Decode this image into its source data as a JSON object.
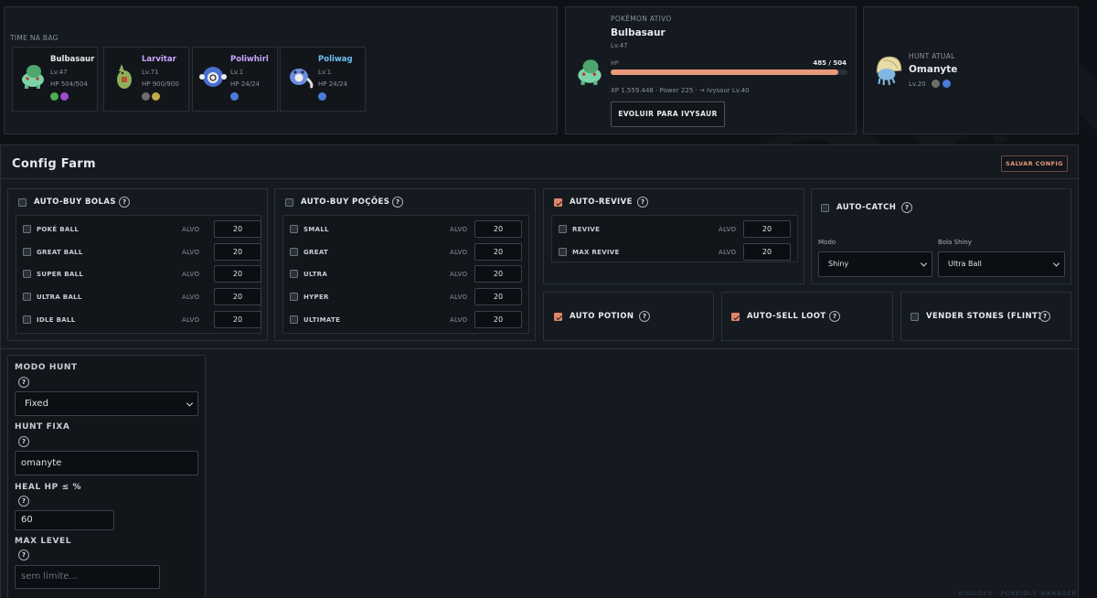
{
  "team": {
    "title": "TIME NA BAG",
    "members": [
      {
        "name": "Bulbasaur",
        "level": "Lv.47",
        "hp": "HP 504/504",
        "name_color": "#e6e9ee",
        "types": [
          "#4caf50",
          "#9c4dcc"
        ]
      },
      {
        "name": "Larvitar",
        "level": "Lv.71",
        "hp": "HP 900/900",
        "name_color": "#c7a6ff",
        "types": [
          "#6d6d6d",
          "#c2a94a"
        ]
      },
      {
        "name": "Poliwhirl",
        "level": "Lv.1",
        "hp": "HP 24/24",
        "name_color": "#c7a6ff",
        "types": [
          "#4a7bd8"
        ]
      },
      {
        "name": "Poliwag",
        "level": "Lv.1",
        "hp": "HP 24/24",
        "name_color": "#6ec0f2",
        "types": [
          "#4a7bd8"
        ]
      }
    ]
  },
  "active": {
    "label": "POKÉMON ATIVO",
    "name": "Bulbasaur",
    "level": "Lv.47",
    "hp_label": "HP",
    "hp_value": "485 / 504",
    "hp_fraction": 0.962,
    "xp_line": "XP 1.559.448 · Power 225 · → Ivysaur Lv.40",
    "evolve_button": "EVOLUIR PARA IVYSAUR"
  },
  "hunt": {
    "label": "HUNT ATUAL",
    "name": "Omanyte",
    "level": "Lv.20"
  },
  "config": {
    "title": "Config Farm",
    "save_button": "SALVAR CONFIG",
    "alvo_label": "ALVO",
    "help": "?",
    "auto_buy_bolas": {
      "title": "AUTO-BUY BOLAS",
      "checked": false,
      "items": [
        {
          "name": "POKÉ BALL",
          "value": "20"
        },
        {
          "name": "GREAT BALL",
          "value": "20"
        },
        {
          "name": "SUPER BALL",
          "value": "20"
        },
        {
          "name": "ULTRA BALL",
          "value": "20"
        },
        {
          "name": "IDLE BALL",
          "value": "20"
        }
      ]
    },
    "auto_buy_pocoes": {
      "title": "AUTO-BUY POÇÕES",
      "checked": false,
      "items": [
        {
          "name": "SMALL",
          "value": "20"
        },
        {
          "name": "GREAT",
          "value": "20"
        },
        {
          "name": "ULTRA",
          "value": "20"
        },
        {
          "name": "HYPER",
          "value": "20"
        },
        {
          "name": "ULTIMATE",
          "value": "20"
        }
      ]
    },
    "auto_revive": {
      "title": "AUTO-REVIVE",
      "checked": true,
      "items": [
        {
          "name": "REVIVE",
          "value": "20"
        },
        {
          "name": "MAX REVIVE",
          "value": "20"
        }
      ]
    },
    "auto_catch": {
      "title": "AUTO-CATCH",
      "checked": false,
      "mode_label": "Modo",
      "mode_value": "Shiny",
      "ball_label": "Bola Shiny",
      "ball_value": "Ultra Ball"
    },
    "auto_potion": {
      "title": "AUTO POTION",
      "checked": true
    },
    "auto_sell_loot": {
      "title": "AUTO-SELL LOOT",
      "checked": true
    },
    "vender_stones": {
      "title": "VENDER STONES (FLINT)",
      "checked": false
    }
  },
  "hunt_settings": {
    "mode_label": "MODO HUNT",
    "mode_value": "Fixed",
    "fixed_label": "HUNT FIXA",
    "fixed_value": "omanyte",
    "heal_label": "HEAL HP ≤ %",
    "heal_value": "60",
    "max_level_label": "MAX LEVEL",
    "max_level_placeholder": "sem limite..."
  },
  "footer": "BIGODEV · POKEIDLE MANAGER",
  "watermark": "BIGODEV"
}
